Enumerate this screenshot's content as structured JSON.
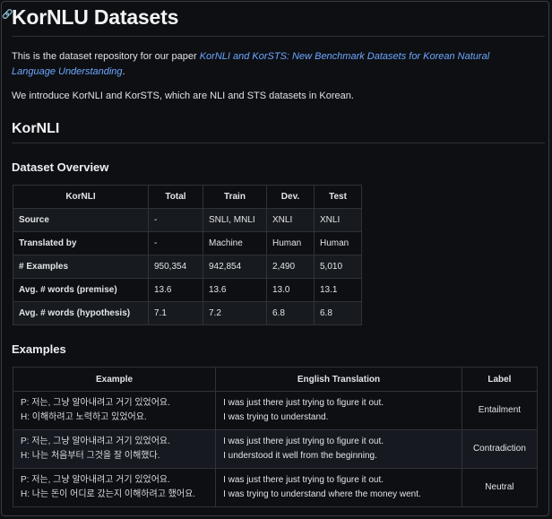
{
  "page": {
    "title": "KorNLU Datasets",
    "intro_prefix": "This is the dataset repository for our paper ",
    "paper_link": "KorNLI and KorSTS: New Benchmark Datasets for Korean Natural Language Understanding",
    "intro_suffix": ".",
    "intro2": "We introduce KorNLI and KorSTS, which are NLI and STS datasets in Korean."
  },
  "section": {
    "title": "KorNLI"
  },
  "overview": {
    "title": "Dataset Overview",
    "headers": [
      "KorNLI",
      "Total",
      "Train",
      "Dev.",
      "Test"
    ],
    "rows": [
      [
        "Source",
        "-",
        "SNLI, MNLI",
        "XNLI",
        "XNLI"
      ],
      [
        "Translated by",
        "-",
        "Machine",
        "Human",
        "Human"
      ],
      [
        "# Examples",
        "950,354",
        "942,854",
        "2,490",
        "5,010"
      ],
      [
        "Avg. # words (premise)",
        "13.6",
        "13.6",
        "13.0",
        "13.1"
      ],
      [
        "Avg. # words (hypothesis)",
        "7.1",
        "7.2",
        "6.8",
        "6.8"
      ]
    ]
  },
  "examples": {
    "title": "Examples",
    "headers": [
      "Example",
      "English Translation",
      "Label"
    ],
    "rows": [
      {
        "ko_p": "P: 저는, 그냥 알아내려고 거기 있었어요.",
        "ko_h": "H: 이해하려고 노력하고 있었어요.",
        "en_p": "I was just there just trying to figure it out.",
        "en_h": "I was trying to understand.",
        "label": "Entailment"
      },
      {
        "ko_p": "P: 저는, 그냥 알아내려고 거기 있었어요.",
        "ko_h": "H: 나는 처음부터 그것을 잘 이해했다.",
        "en_p": "I was just there just trying to figure it out.",
        "en_h": "I understood it well from the beginning.",
        "label": "Contradiction"
      },
      {
        "ko_p": "P: 저는, 그냥 알아내려고 거기 있었어요.",
        "ko_h": "H: 나는 돈이 어디로 갔는지 이해하려고 했어요.",
        "en_p": "I was just there just trying to figure it out.",
        "en_h": "I was trying to understand where the money went.",
        "label": "Neutral"
      }
    ]
  }
}
